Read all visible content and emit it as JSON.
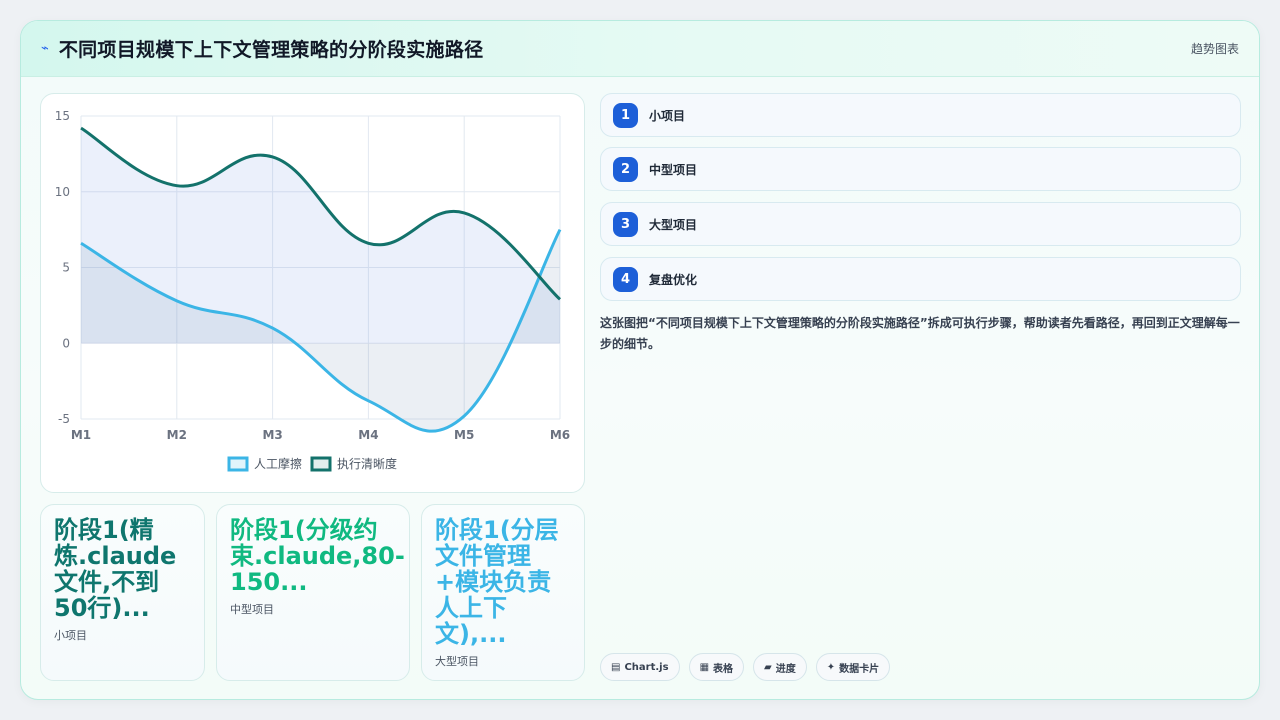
{
  "header": {
    "icon": "lightning-icon",
    "title": "不同项目规模下上下文管理策略的分阶段实施路径",
    "tag": "趋势图表"
  },
  "chart_data": {
    "type": "line",
    "categories": [
      "M1",
      "M2",
      "M3",
      "M4",
      "M5",
      "M6"
    ],
    "ylim": [
      -5,
      15
    ],
    "yticks": [
      15,
      10,
      5,
      0,
      -5
    ],
    "grid": true,
    "legend": "bottom",
    "series": [
      {
        "name": "人工摩擦",
        "values": [
          6.6,
          2.8,
          1.0,
          -3.8,
          -4.8,
          7.5
        ],
        "color": "#3bb5e6",
        "fill": "rgba(100,130,170,0.13)"
      },
      {
        "name": "执行清晰度",
        "values": [
          14.2,
          10.4,
          12.3,
          6.6,
          8.6,
          2.9
        ],
        "color": "#13726b",
        "fill": "rgba(110,150,230,0.14)"
      }
    ]
  },
  "stats": [
    {
      "value": "阶段1(精炼.claude文件,不到50行)...",
      "label": "小项目",
      "color": "#0f766e"
    },
    {
      "value": "阶段1(分级约束.claude,80-150...",
      "label": "中型项目",
      "color": "#10b981"
    },
    {
      "value": "阶段1(分层文件管理+模块负责人上下文),...",
      "label": "大型项目",
      "color": "#3bb5e6"
    }
  ],
  "steps": [
    {
      "num": "1",
      "label": "小项目"
    },
    {
      "num": "2",
      "label": "中型项目"
    },
    {
      "num": "3",
      "label": "大型项目"
    },
    {
      "num": "4",
      "label": "复盘优化"
    }
  ],
  "description": "这张图把“不同项目规模下上下文管理策略的分阶段实施路径”拆成可执行步骤，帮助读者先看路径，再回到正文理解每一步的细节。",
  "chips": [
    {
      "icon": "chart-icon",
      "glyph": "▤",
      "label": "Chart.js"
    },
    {
      "icon": "table-icon",
      "glyph": "▦",
      "label": "表格"
    },
    {
      "icon": "progress-icon",
      "glyph": "▰",
      "label": "进度"
    },
    {
      "icon": "sparkle-icon",
      "glyph": "✦",
      "label": "数据卡片"
    }
  ]
}
